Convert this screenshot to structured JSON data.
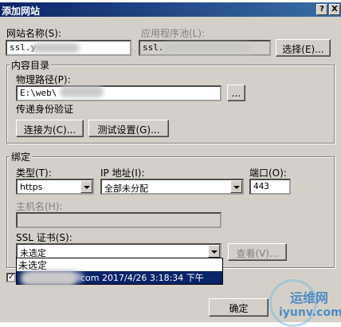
{
  "window": {
    "title": "添加网站",
    "help_btn": "?",
    "close_btn": "X"
  },
  "site": {
    "name_label": "网站名称(S):",
    "name_value": "ssl.y",
    "pool_label": "应用程序池(L):",
    "pool_value": "ssl.",
    "select_btn": "选择(E)..."
  },
  "content": {
    "group_title": "内容目录",
    "path_label": "物理路径(P):",
    "path_value": "E:\\web\\",
    "browse_btn": "...",
    "auth_label": "传递身份验证",
    "connect_btn": "连接为(C)...",
    "test_btn": "测试设置(G)..."
  },
  "binding": {
    "group_title": "绑定",
    "type_label": "类型(T):",
    "type_value": "https",
    "ip_label": "IP 地址(I):",
    "ip_value": "全部未分配",
    "port_label": "端口(O):",
    "port_value": "443",
    "host_label": "主机名(H):",
    "host_value": "",
    "ssl_label": "SSL 证书(S):",
    "ssl_value": "未选定",
    "view_btn": "查看(V)..."
  },
  "dropdown": {
    "options": [
      "未选定",
      "com 2017/4/26 3:18:34 下午"
    ]
  },
  "footer": {
    "ok_btn": "确定",
    "checkbox_checked": true
  },
  "watermark": {
    "line1": "运维网",
    "line2": "iyunv.com"
  }
}
